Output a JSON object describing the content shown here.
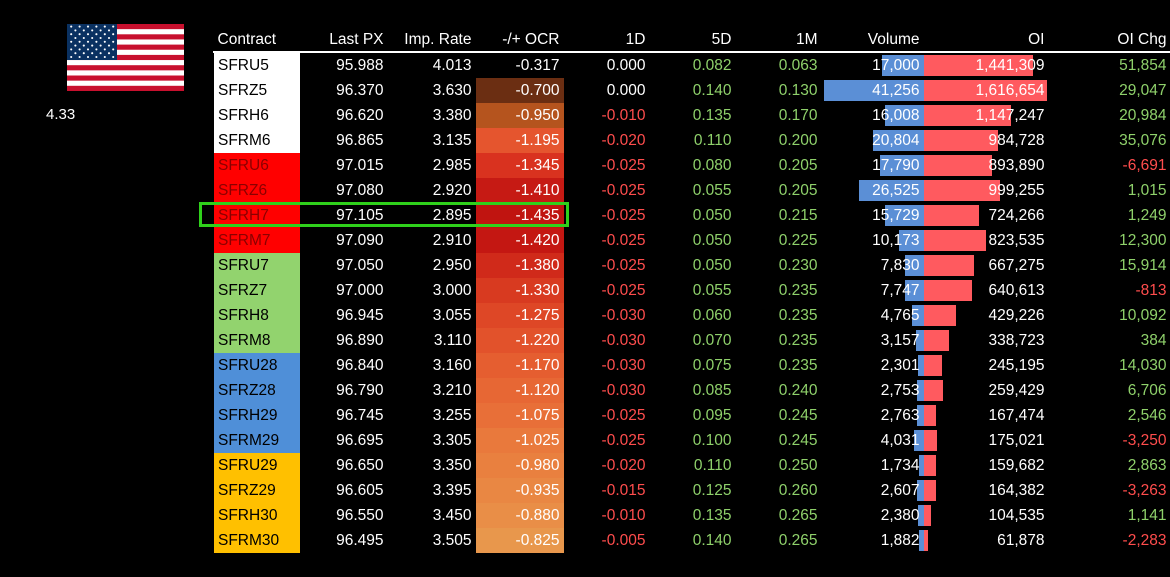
{
  "flag": {
    "icon": "us-flag-icon"
  },
  "reference_rate": "4.33",
  "columns": [
    "Contract",
    "Last PX",
    "Imp. Rate",
    "-/+ OCR",
    "1D",
    "5D",
    "1M",
    "Volume",
    "OI",
    "OI Chg"
  ],
  "colors": {
    "white": "#ffffff",
    "red": "#ff0000",
    "green": "#92d36e",
    "blue": "#4f8fd8",
    "gold": "#ffc000",
    "accent_green": "#2fd11b",
    "neg_text": "#ff4d4d",
    "pos_text": "#8fd16b",
    "vol_bar": "#5b8fd6",
    "oi_bar": "#ff5a5f"
  },
  "max_volume": 41256,
  "max_oi": 1616654,
  "highlight_row": "SFRH7",
  "rows": [
    {
      "contract": "SFRU5",
      "group": "white",
      "px": "95.988",
      "rate": "4.013",
      "ocr": "-0.317",
      "d1": "0.000",
      "d5": "0.082",
      "m1": "0.063",
      "vol": "17,000",
      "vol_n": 17000,
      "oi": "1,441,309",
      "oi_n": 1441309,
      "oichg": "51,854",
      "ocr_color": "#000000"
    },
    {
      "contract": "SFRZ5",
      "group": "white",
      "px": "96.370",
      "rate": "3.630",
      "ocr": "-0.700",
      "d1": "0.000",
      "d5": "0.140",
      "m1": "0.130",
      "vol": "41,256",
      "vol_n": 41256,
      "oi": "1,616,654",
      "oi_n": 1616654,
      "oichg": "29,047",
      "ocr_color": "#6b2e12"
    },
    {
      "contract": "SFRH6",
      "group": "white",
      "px": "96.620",
      "rate": "3.380",
      "ocr": "-0.950",
      "d1": "-0.010",
      "d5": "0.135",
      "m1": "0.170",
      "vol": "16,008",
      "vol_n": 16008,
      "oi": "1,147,247",
      "oi_n": 1147247,
      "oichg": "20,984",
      "ocr_color": "#b5541e"
    },
    {
      "contract": "SFRM6",
      "group": "white",
      "px": "96.865",
      "rate": "3.135",
      "ocr": "-1.195",
      "d1": "-0.020",
      "d5": "0.110",
      "m1": "0.200",
      "vol": "20,804",
      "vol_n": 20804,
      "oi": "984,728",
      "oi_n": 984728,
      "oichg": "35,076",
      "ocr_color": "#e5552e"
    },
    {
      "contract": "SFRU6",
      "group": "red",
      "px": "97.015",
      "rate": "2.985",
      "ocr": "-1.345",
      "d1": "-0.025",
      "d5": "0.080",
      "m1": "0.205",
      "vol": "17,790",
      "vol_n": 17790,
      "oi": "893,890",
      "oi_n": 893890,
      "oichg": "-6,691",
      "ocr_color": "#d9321f"
    },
    {
      "contract": "SFRZ6",
      "group": "red",
      "px": "97.080",
      "rate": "2.920",
      "ocr": "-1.410",
      "d1": "-0.025",
      "d5": "0.055",
      "m1": "0.205",
      "vol": "26,525",
      "vol_n": 26525,
      "oi": "999,255",
      "oi_n": 999255,
      "oichg": "1,015",
      "ocr_color": "#c61a14"
    },
    {
      "contract": "SFRH7",
      "group": "red",
      "px": "97.105",
      "rate": "2.895",
      "ocr": "-1.435",
      "d1": "-0.025",
      "d5": "0.050",
      "m1": "0.215",
      "vol": "15,729",
      "vol_n": 15729,
      "oi": "724,266",
      "oi_n": 724266,
      "oichg": "1,249",
      "ocr_color": "#c01410"
    },
    {
      "contract": "SFRM7",
      "group": "red",
      "px": "97.090",
      "rate": "2.910",
      "ocr": "-1.420",
      "d1": "-0.025",
      "d5": "0.050",
      "m1": "0.225",
      "vol": "10,173",
      "vol_n": 10173,
      "oi": "823,535",
      "oi_n": 823535,
      "oichg": "12,300",
      "ocr_color": "#c41712"
    },
    {
      "contract": "SFRU7",
      "group": "green",
      "px": "97.050",
      "rate": "2.950",
      "ocr": "-1.380",
      "d1": "-0.025",
      "d5": "0.050",
      "m1": "0.230",
      "vol": "7,830",
      "vol_n": 7830,
      "oi": "667,275",
      "oi_n": 667275,
      "oichg": "15,914",
      "ocr_color": "#d02a1a"
    },
    {
      "contract": "SFRZ7",
      "group": "green",
      "px": "97.000",
      "rate": "3.000",
      "ocr": "-1.330",
      "d1": "-0.025",
      "d5": "0.055",
      "m1": "0.235",
      "vol": "7,747",
      "vol_n": 7747,
      "oi": "640,613",
      "oi_n": 640613,
      "oichg": "-813",
      "ocr_color": "#d83a20"
    },
    {
      "contract": "SFRH8",
      "group": "green",
      "px": "96.945",
      "rate": "3.055",
      "ocr": "-1.275",
      "d1": "-0.030",
      "d5": "0.060",
      "m1": "0.235",
      "vol": "4,765",
      "vol_n": 4765,
      "oi": "429,226",
      "oi_n": 429226,
      "oichg": "10,092",
      "ocr_color": "#de4726"
    },
    {
      "contract": "SFRM8",
      "group": "green",
      "px": "96.890",
      "rate": "3.110",
      "ocr": "-1.220",
      "d1": "-0.030",
      "d5": "0.070",
      "m1": "0.235",
      "vol": "3,157",
      "vol_n": 3157,
      "oi": "338,723",
      "oi_n": 338723,
      "oichg": "384",
      "ocr_color": "#e2522b"
    },
    {
      "contract": "SFRU28",
      "group": "blue",
      "px": "96.840",
      "rate": "3.160",
      "ocr": "-1.170",
      "d1": "-0.030",
      "d5": "0.075",
      "m1": "0.235",
      "vol": "2,301",
      "vol_n": 2301,
      "oi": "245,195",
      "oi_n": 245195,
      "oichg": "14,030",
      "ocr_color": "#e55e30"
    },
    {
      "contract": "SFRZ28",
      "group": "blue",
      "px": "96.790",
      "rate": "3.210",
      "ocr": "-1.120",
      "d1": "-0.030",
      "d5": "0.085",
      "m1": "0.240",
      "vol": "2,753",
      "vol_n": 2753,
      "oi": "259,429",
      "oi_n": 259429,
      "oichg": "6,706",
      "ocr_color": "#e76734"
    },
    {
      "contract": "SFRH29",
      "group": "blue",
      "px": "96.745",
      "rate": "3.255",
      "ocr": "-1.075",
      "d1": "-0.025",
      "d5": "0.095",
      "m1": "0.245",
      "vol": "2,763",
      "vol_n": 2763,
      "oi": "167,474",
      "oi_n": 167474,
      "oichg": "2,546",
      "ocr_color": "#e86f38"
    },
    {
      "contract": "SFRM29",
      "group": "blue",
      "px": "96.695",
      "rate": "3.305",
      "ocr": "-1.025",
      "d1": "-0.025",
      "d5": "0.100",
      "m1": "0.245",
      "vol": "4,031",
      "vol_n": 4031,
      "oi": "175,021",
      "oi_n": 175021,
      "oichg": "-3,250",
      "ocr_color": "#e9793c"
    },
    {
      "contract": "SFRU29",
      "group": "gold",
      "px": "96.650",
      "rate": "3.350",
      "ocr": "-0.980",
      "d1": "-0.020",
      "d5": "0.110",
      "m1": "0.250",
      "vol": "1,734",
      "vol_n": 1734,
      "oi": "159,682",
      "oi_n": 159682,
      "oichg": "2,863",
      "ocr_color": "#e9803f"
    },
    {
      "contract": "SFRZ29",
      "group": "gold",
      "px": "96.605",
      "rate": "3.395",
      "ocr": "-0.935",
      "d1": "-0.015",
      "d5": "0.125",
      "m1": "0.260",
      "vol": "2,607",
      "vol_n": 2607,
      "oi": "164,382",
      "oi_n": 164382,
      "oichg": "-3,263",
      "ocr_color": "#e98743"
    },
    {
      "contract": "SFRH30",
      "group": "gold",
      "px": "96.550",
      "rate": "3.450",
      "ocr": "-0.880",
      "d1": "-0.010",
      "d5": "0.135",
      "m1": "0.265",
      "vol": "2,380",
      "vol_n": 2380,
      "oi": "104,535",
      "oi_n": 104535,
      "oichg": "1,141",
      "ocr_color": "#e98e47"
    },
    {
      "contract": "SFRM30",
      "group": "gold",
      "px": "96.495",
      "rate": "3.505",
      "ocr": "-0.825",
      "d1": "-0.005",
      "d5": "0.140",
      "m1": "0.265",
      "vol": "1,882",
      "vol_n": 1882,
      "oi": "61,878",
      "oi_n": 61878,
      "oichg": "-2,283",
      "ocr_color": "#e8974c"
    }
  ]
}
